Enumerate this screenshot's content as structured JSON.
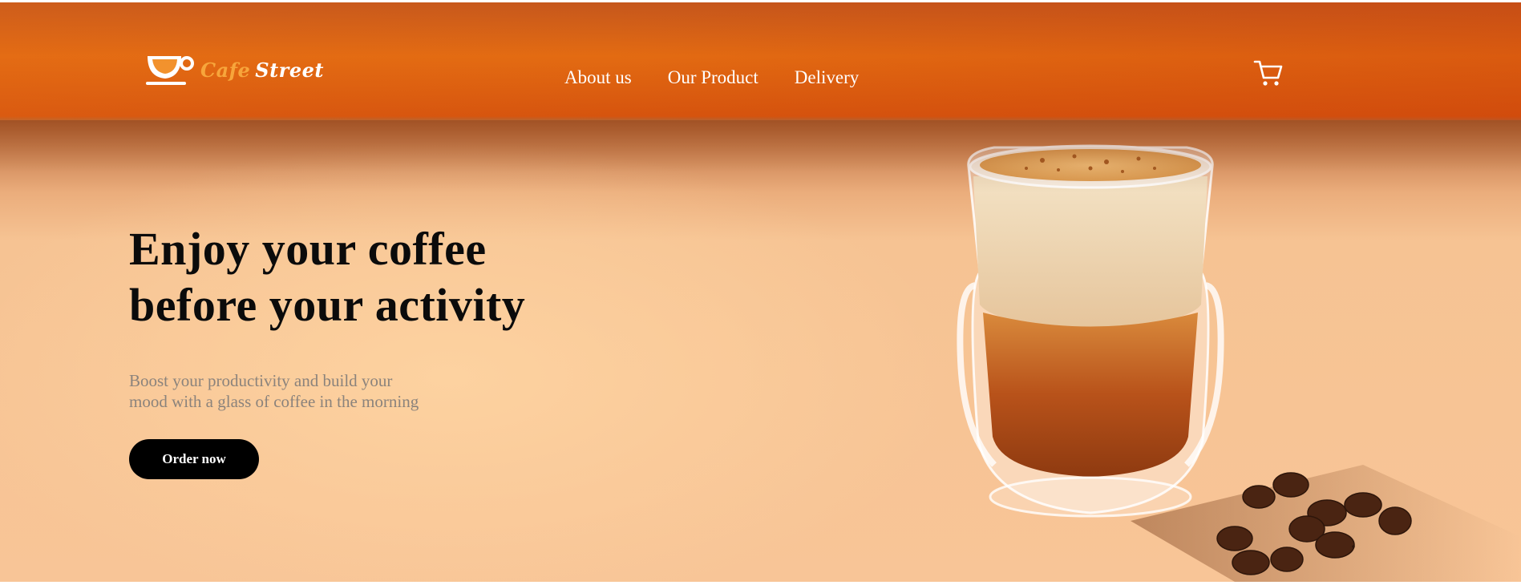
{
  "brand": {
    "name_part1": "Cafe",
    "name_part2": "Street",
    "icon": "coffee-cup-logo-icon"
  },
  "nav": {
    "items": [
      {
        "label": "About us"
      },
      {
        "label": "Our Product"
      },
      {
        "label": "Delivery"
      }
    ],
    "cart_icon": "shopping-cart-icon"
  },
  "hero": {
    "headline": "Enjoy your coffee\nbefore your activity",
    "subtext": "Boost your productivity and build your\nmood with a glass of coffee in the morning",
    "cta_label": "Order now",
    "image_subject": "glass-of-latte-with-coffee-beans"
  },
  "colors": {
    "header_orange": "#e36b12",
    "brand_accent": "#f7a53b",
    "cta_background": "#000000",
    "subtext_gray": "#8b837c"
  }
}
